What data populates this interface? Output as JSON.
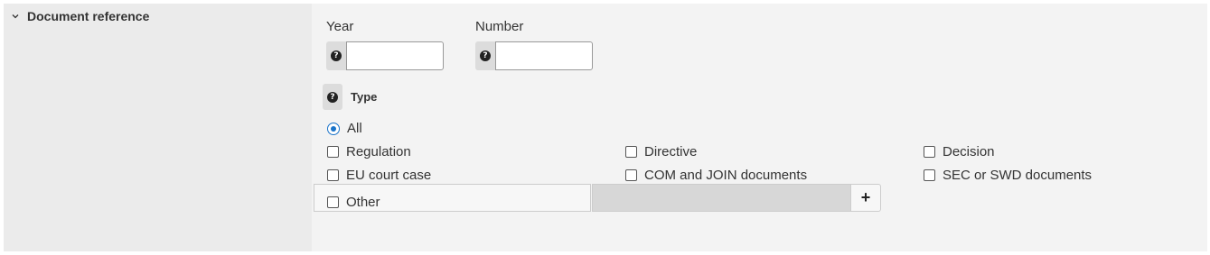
{
  "section": {
    "title": "Document reference"
  },
  "fields": {
    "year": {
      "label": "Year",
      "value": "",
      "help_icon": "question-circle-icon"
    },
    "number": {
      "label": "Number",
      "value": "",
      "help_icon": "question-circle-icon"
    }
  },
  "type": {
    "label": "Type",
    "help_icon": "question-circle-icon",
    "all_label": "All",
    "all_selected": true,
    "options": [
      {
        "label": "Regulation",
        "checked": false
      },
      {
        "label": "Directive",
        "checked": false
      },
      {
        "label": "Decision",
        "checked": false
      },
      {
        "label": "EU court case",
        "checked": false
      },
      {
        "label": "COM and JOIN documents",
        "checked": false
      },
      {
        "label": "SEC or SWD documents",
        "checked": false
      }
    ],
    "other": {
      "label": "Other",
      "checked": false,
      "value": "",
      "add_icon": "plus-icon"
    }
  },
  "colors": {
    "accent": "#1a73c9",
    "panel": "#f3f3f3",
    "left_column": "#ebebeb"
  }
}
